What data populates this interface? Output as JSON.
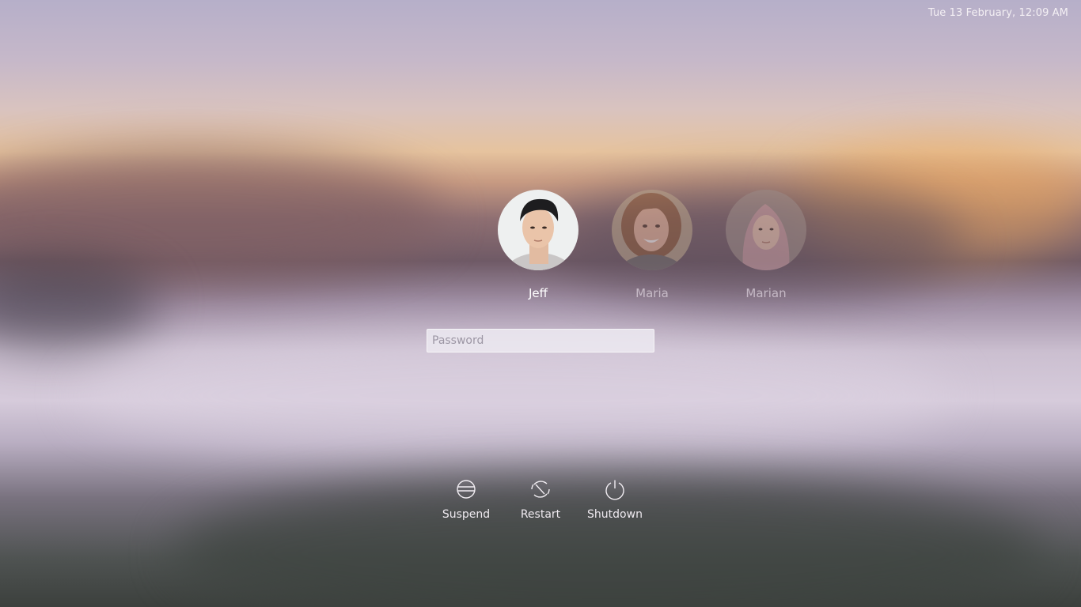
{
  "clock": {
    "text": "Tue 13 February, 12:09 AM"
  },
  "users": [
    {
      "name": "Jeff",
      "active": true
    },
    {
      "name": "Maria",
      "active": false
    },
    {
      "name": "Marian",
      "active": false
    }
  ],
  "password": {
    "placeholder": "Password",
    "value": ""
  },
  "power_actions": [
    {
      "label": "Suspend",
      "icon": "suspend-icon"
    },
    {
      "label": "Restart",
      "icon": "restart-icon"
    },
    {
      "label": "Shutdown",
      "icon": "power-icon"
    }
  ],
  "colors": {
    "text_light": "#ffffff",
    "inactive_text": "#b9aebc",
    "input_background": "#ece8f0"
  }
}
